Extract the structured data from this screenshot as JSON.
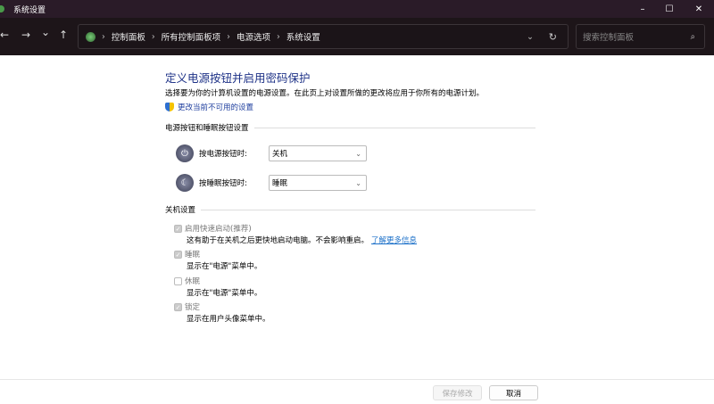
{
  "window": {
    "title": "系统设置",
    "minimize": "–",
    "maximize": "☐",
    "close": "✕"
  },
  "nav": {
    "back": "←",
    "forward": "→",
    "recent": "⌄",
    "up": "↑"
  },
  "breadcrumb": [
    "控制面板",
    "所有控制面板项",
    "电源选项",
    "系统设置"
  ],
  "search": {
    "placeholder": "搜索控制面板"
  },
  "page": {
    "title": "定义电源按钮并启用密码保护",
    "description": "选择要为你的计算机设置的电源设置。在此页上对设置所做的更改将应用于你所有的电源计划。",
    "change_link": "更改当前不可用的设置",
    "section1": "电源按钮和睡眠按钮设置",
    "power_label": "按电源按钮时:",
    "power_value": "关机",
    "sleep_label": "按睡眠按钮时:",
    "sleep_value": "睡眠",
    "section2": "关机设置",
    "options": [
      {
        "label": "启用快速启动(推荐)",
        "desc": "这有助于在关机之后更快地启动电脑。不会影响重启。",
        "link": "了解更多信息",
        "checked": true
      },
      {
        "label": "睡眠",
        "desc": "显示在\"电源\"菜单中。",
        "checked": true
      },
      {
        "label": "休眠",
        "desc": "显示在\"电源\"菜单中。",
        "checked": false
      },
      {
        "label": "锁定",
        "desc": "显示在用户头像菜单中。",
        "checked": true
      }
    ]
  },
  "footer": {
    "save": "保存修改",
    "cancel": "取消"
  }
}
